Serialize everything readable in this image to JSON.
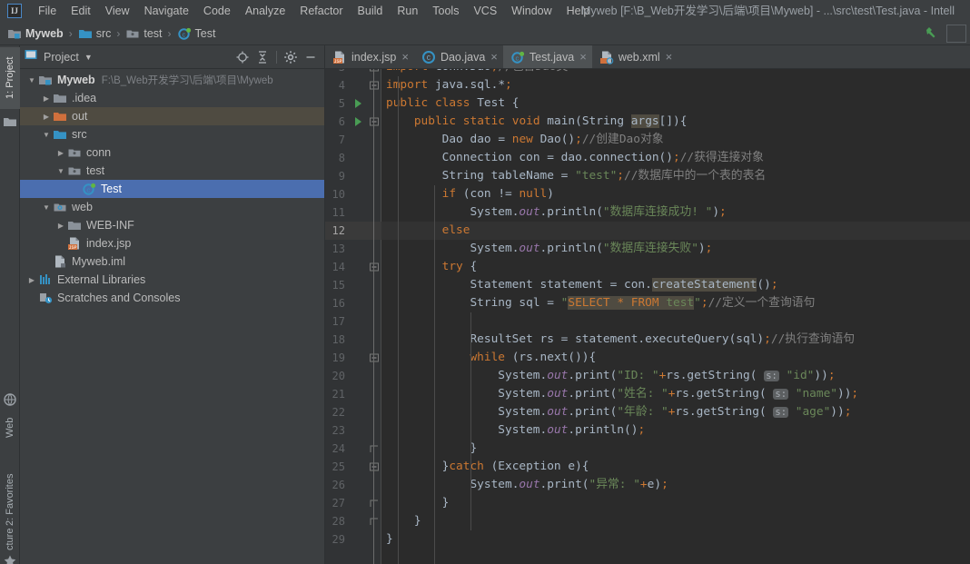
{
  "window": {
    "title": "Myweb [F:\\B_Web开发学习\\后端\\项目\\Myweb] - ...\\src\\test\\Test.java - Intell",
    "logo": "IJ"
  },
  "menubar": {
    "items": [
      {
        "label": "File"
      },
      {
        "label": "Edit"
      },
      {
        "label": "View"
      },
      {
        "label": "Navigate"
      },
      {
        "label": "Code"
      },
      {
        "label": "Analyze"
      },
      {
        "label": "Refactor"
      },
      {
        "label": "Build"
      },
      {
        "label": "Run"
      },
      {
        "label": "Tools"
      },
      {
        "label": "VCS"
      },
      {
        "label": "Window"
      },
      {
        "label": "Help"
      }
    ]
  },
  "breadcrumb": {
    "items": [
      {
        "label": "Myweb",
        "icon": "module-icon",
        "bold": true
      },
      {
        "label": "src",
        "icon": "source-folder-icon",
        "bold": false
      },
      {
        "label": "test",
        "icon": "package-icon",
        "bold": false
      },
      {
        "label": "Test",
        "icon": "java-class-icon",
        "bold": false
      }
    ],
    "separator": "›",
    "build_icon": "hammer-icon"
  },
  "toolstrip": {
    "top_label": "1: Project",
    "items": [
      {
        "label": "Web",
        "icon": "web-globe-icon"
      },
      {
        "label": "2: Favorites",
        "icon": "star-icon"
      },
      {
        "label": "cture",
        "icon": "structure-icon"
      }
    ]
  },
  "project_panel": {
    "title": "Project",
    "dropdown_icon": "chevron-down-icon",
    "actions": [
      {
        "name": "locate-icon",
        "glyph": "⊕"
      },
      {
        "name": "collapse-all-icon",
        "glyph": "≡"
      },
      {
        "name": "settings-gear-icon",
        "glyph": "⚙"
      },
      {
        "name": "hide-panel-icon",
        "glyph": "—"
      }
    ],
    "tree": [
      {
        "label": "Myweb",
        "path": "F:\\B_Web开发学习\\后端\\项目\\Myweb",
        "depth": 0,
        "twist": "▼",
        "icon": "module-icon",
        "bold": true,
        "state": "normal"
      },
      {
        "label": ".idea",
        "path": "",
        "depth": 1,
        "twist": "▶",
        "icon": "folder-gray-icon",
        "bold": false,
        "state": "normal"
      },
      {
        "label": "out",
        "path": "",
        "depth": 1,
        "twist": "▶",
        "icon": "folder-orange-icon",
        "bold": false,
        "state": "marked"
      },
      {
        "label": "src",
        "path": "",
        "depth": 1,
        "twist": "▼",
        "icon": "folder-blue-icon",
        "bold": false,
        "state": "normal"
      },
      {
        "label": "conn",
        "path": "",
        "depth": 2,
        "twist": "▶",
        "icon": "package-icon",
        "bold": false,
        "state": "normal"
      },
      {
        "label": "test",
        "path": "",
        "depth": 2,
        "twist": "▼",
        "icon": "package-icon",
        "bold": false,
        "state": "normal"
      },
      {
        "label": "Test",
        "path": "",
        "depth": 3,
        "twist": "",
        "icon": "java-class-icon",
        "bold": false,
        "state": "selected"
      },
      {
        "label": "web",
        "path": "",
        "depth": 1,
        "twist": "▼",
        "icon": "web-folder-icon",
        "bold": false,
        "state": "normal"
      },
      {
        "label": "WEB-INF",
        "path": "",
        "depth": 2,
        "twist": "▶",
        "icon": "folder-gray-icon",
        "bold": false,
        "state": "normal"
      },
      {
        "label": "index.jsp",
        "path": "",
        "depth": 2,
        "twist": "",
        "icon": "jsp-file-icon",
        "bold": false,
        "state": "normal"
      },
      {
        "label": "Myweb.iml",
        "path": "",
        "depth": 1,
        "twist": "",
        "icon": "iml-file-icon",
        "bold": false,
        "state": "normal"
      },
      {
        "label": "External Libraries",
        "path": "",
        "depth": 0,
        "twist": "▶",
        "icon": "libraries-icon",
        "bold": false,
        "state": "normal"
      },
      {
        "label": "Scratches and Consoles",
        "path": "",
        "depth": 0,
        "twist": "",
        "icon": "scratches-icon",
        "bold": false,
        "state": "normal"
      }
    ]
  },
  "editor": {
    "tabs": [
      {
        "label": "index.jsp",
        "icon": "jsp-file-icon",
        "active": false,
        "close": "×"
      },
      {
        "label": "Dao.java",
        "icon": "java-class-icon-blue",
        "active": false,
        "close": "×"
      },
      {
        "label": "Test.java",
        "icon": "java-class-icon",
        "active": true,
        "close": "×"
      },
      {
        "label": "web.xml",
        "icon": "xml-file-icon",
        "active": false,
        "close": "×"
      }
    ],
    "current_line": 12,
    "first_visible_line": 3,
    "lines": [
      {
        "n": 3,
        "run": false,
        "fold": "collapse",
        "text": "import conn.Dao;//包含Dao类",
        "clipped_top": true
      },
      {
        "n": 4,
        "run": false,
        "fold": "collapse",
        "text": "import java.sql.*;"
      },
      {
        "n": 5,
        "run": true,
        "fold": "",
        "text": "public class Test {"
      },
      {
        "n": 6,
        "run": true,
        "fold": "collapse",
        "text": "    public static void main(String args[]){"
      },
      {
        "n": 7,
        "run": false,
        "fold": "",
        "text": "        Dao dao = new Dao();//创建Dao对象"
      },
      {
        "n": 8,
        "run": false,
        "fold": "",
        "text": "        Connection con = dao.connection();//获得连接对象"
      },
      {
        "n": 9,
        "run": false,
        "fold": "",
        "text": "        String tableName = \"test\";//数据库中的一个表的表名"
      },
      {
        "n": 10,
        "run": false,
        "fold": "",
        "text": "        if (con != null)"
      },
      {
        "n": 11,
        "run": false,
        "fold": "",
        "text": "            System.out.println(\"数据库连接成功! \");"
      },
      {
        "n": 12,
        "run": false,
        "fold": "",
        "text": "        else"
      },
      {
        "n": 13,
        "run": false,
        "fold": "",
        "text": "            System.out.println(\"数据库连接失败\");"
      },
      {
        "n": 14,
        "run": false,
        "fold": "collapse",
        "text": "        try {"
      },
      {
        "n": 15,
        "run": false,
        "fold": "",
        "text": "            Statement statement = con.createStatement();"
      },
      {
        "n": 16,
        "run": false,
        "fold": "",
        "text": "            String sql = \"SELECT * FROM test\";//定义一个查询语句"
      },
      {
        "n": 17,
        "run": false,
        "fold": "",
        "text": ""
      },
      {
        "n": 18,
        "run": false,
        "fold": "",
        "text": "            ResultSet rs = statement.executeQuery(sql);//执行查询语句"
      },
      {
        "n": 19,
        "run": false,
        "fold": "collapse",
        "text": "            while (rs.next()){"
      },
      {
        "n": 20,
        "run": false,
        "fold": "",
        "text": "                System.out.print(\"ID: \"+rs.getString( s: \"id\"));"
      },
      {
        "n": 21,
        "run": false,
        "fold": "",
        "text": "                System.out.print(\"姓名: \"+rs.getString( s: \"name\"));"
      },
      {
        "n": 22,
        "run": false,
        "fold": "",
        "text": "                System.out.print(\"年龄: \"+rs.getString( s: \"age\"));"
      },
      {
        "n": 23,
        "run": false,
        "fold": "",
        "text": "                System.out.println();"
      },
      {
        "n": 24,
        "run": false,
        "fold": "end",
        "text": "            }"
      },
      {
        "n": 25,
        "run": false,
        "fold": "collapse",
        "text": "        }catch (Exception e){"
      },
      {
        "n": 26,
        "run": false,
        "fold": "",
        "text": "            System.out.print(\"异常: \"+e);"
      },
      {
        "n": 27,
        "run": false,
        "fold": "end",
        "text": "        }"
      },
      {
        "n": 28,
        "run": false,
        "fold": "end",
        "text": "    }"
      },
      {
        "n": 29,
        "run": false,
        "fold": "",
        "text": "}"
      }
    ],
    "highlighted_identifier": "args",
    "highlighted_method": "createStatement",
    "highlighted_sql": "SELECT * FROM test",
    "param_hint": "s:"
  },
  "colors": {
    "chrome_bg": "#3c3f41",
    "editor_bg": "#2b2b2b",
    "gutter_bg": "#313335",
    "selection_blue": "#4b6eaf",
    "marked_olive": "#4f4b41",
    "keyword_orange": "#cc7832",
    "string_green": "#6a8759",
    "comment_gray": "#808080",
    "field_purple": "#9876aa",
    "text_default": "#a9b7c6",
    "run_green": "#499c54",
    "folder_orange": "#d0703c",
    "folder_blue": "#3592c4"
  }
}
